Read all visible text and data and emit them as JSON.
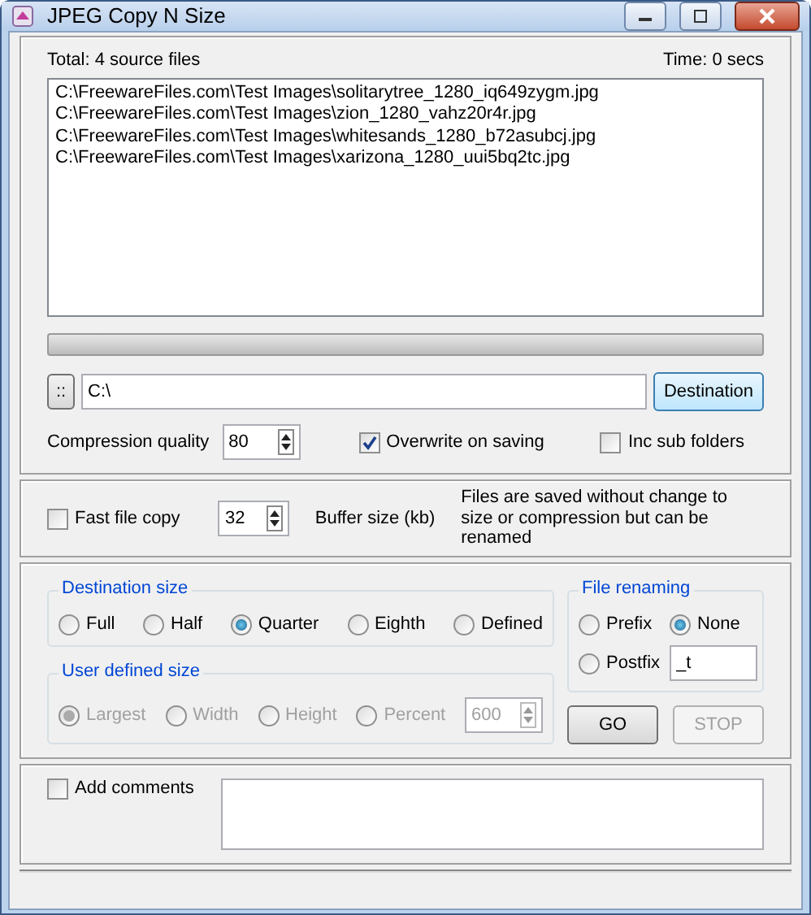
{
  "window": {
    "title": "JPEG Copy N Size"
  },
  "source": {
    "total": "Total: 4 source files",
    "time": "Time: 0 secs",
    "files": [
      "C:\\FreewareFiles.com\\Test Images\\solitarytree_1280_iq649zygm.jpg",
      "C:\\FreewareFiles.com\\Test Images\\zion_1280_vahz20r4r.jpg",
      "C:\\FreewareFiles.com\\Test Images\\whitesands_1280_b72asubcj.jpg",
      "C:\\FreewareFiles.com\\Test Images\\xarizona_1280_uui5bq2tc.jpg"
    ],
    "progress": {
      "level": 0
    }
  },
  "destination": {
    "browse_button": "::",
    "path": "C:\\",
    "button": "Destination"
  },
  "options": {
    "quality_label": "Compression quality",
    "quality": "80",
    "overwrite": {
      "label": "Overwrite on saving",
      "checked": true
    },
    "sub_folders": {
      "label": "Inc sub folders",
      "checked": false
    }
  },
  "fast_copy": {
    "checkbox": {
      "label": "Fast file copy",
      "checked": false
    },
    "buffer": "32",
    "buffer_label": "Buffer size (kb)",
    "note": "Files are saved without change to size or compression but can be renamed"
  },
  "destination_size": {
    "title": "Destination size",
    "options": [
      {
        "label": "Full",
        "selected": false
      },
      {
        "label": "Half",
        "selected": false
      },
      {
        "label": "Quarter",
        "selected": true
      },
      {
        "label": "Eighth",
        "selected": false
      },
      {
        "label": "Defined",
        "selected": false
      }
    ]
  },
  "user_defined_size": {
    "title": "User defined size",
    "disabled": true,
    "options": [
      {
        "label": "Largest",
        "selected": true
      },
      {
        "label": "Width",
        "selected": false
      },
      {
        "label": "Height",
        "selected": false
      },
      {
        "label": "Percent",
        "selected": false
      }
    ],
    "value": "600"
  },
  "file_renaming": {
    "title": "File renaming",
    "options": [
      {
        "label": "Prefix",
        "selected": false
      },
      {
        "label": "None",
        "selected": true
      },
      {
        "label": "Postfix",
        "selected": false
      }
    ],
    "suffix": "_t"
  },
  "buttons": [
    {
      "label": "GO",
      "disabled": false
    },
    {
      "label": "STOP",
      "disabled": true
    }
  ],
  "comments": {
    "checkbox": {
      "label": "Add comments",
      "checked": false
    }
  }
}
